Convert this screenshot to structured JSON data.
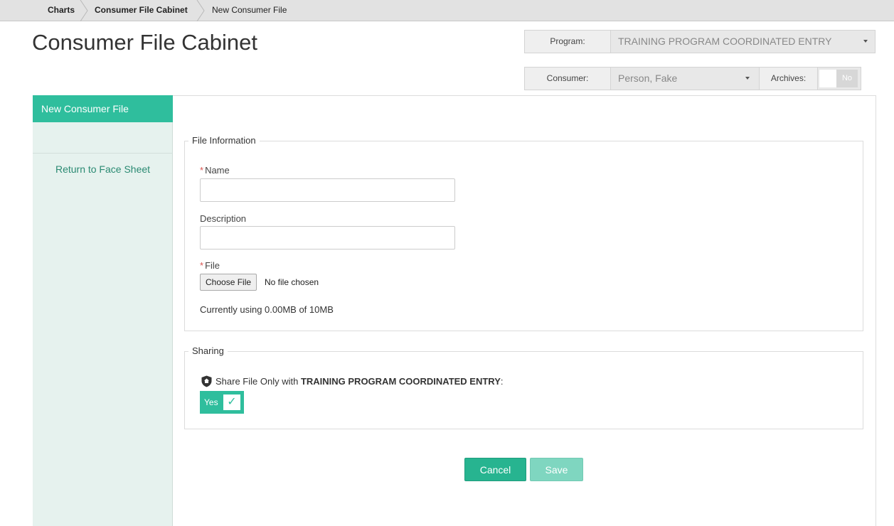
{
  "breadcrumb": {
    "items": [
      "Charts",
      "Consumer File Cabinet",
      "New Consumer File"
    ]
  },
  "page": {
    "title": "Consumer File Cabinet"
  },
  "selectors": {
    "program_label": "Program:",
    "program_value": "TRAINING PROGRAM COORDINATED ENTRY",
    "consumer_label": "Consumer:",
    "consumer_value": "Person, Fake",
    "archives_label": "Archives:",
    "archives_value": "No"
  },
  "sidebar": {
    "active_item": "New Consumer File",
    "link": "Return to Face Sheet"
  },
  "file_info": {
    "legend": "File Information",
    "required_marker": "*",
    "name_label": "Name",
    "name_value": "",
    "description_label": "Description",
    "description_value": "",
    "file_label": "File",
    "choose_button": "Choose File",
    "no_file_text": "No file chosen",
    "usage_text": "Currently using 0.00MB of 10MB"
  },
  "sharing": {
    "legend": "Sharing",
    "share_prefix": "Share File Only with ",
    "share_program": "TRAINING PROGRAM COORDINATED ENTRY",
    "share_suffix": ":",
    "toggle_label": "Yes",
    "toggle_check": "✓",
    "icon": "shield-home-icon"
  },
  "actions": {
    "cancel_label": "Cancel",
    "save_label": "Save"
  },
  "colors": {
    "accent": "#2fbe9d",
    "accent_light": "#7fd6c0",
    "sidebar_bg": "#e6f2ee",
    "link": "#2a8a72",
    "required": "#d9534f"
  }
}
